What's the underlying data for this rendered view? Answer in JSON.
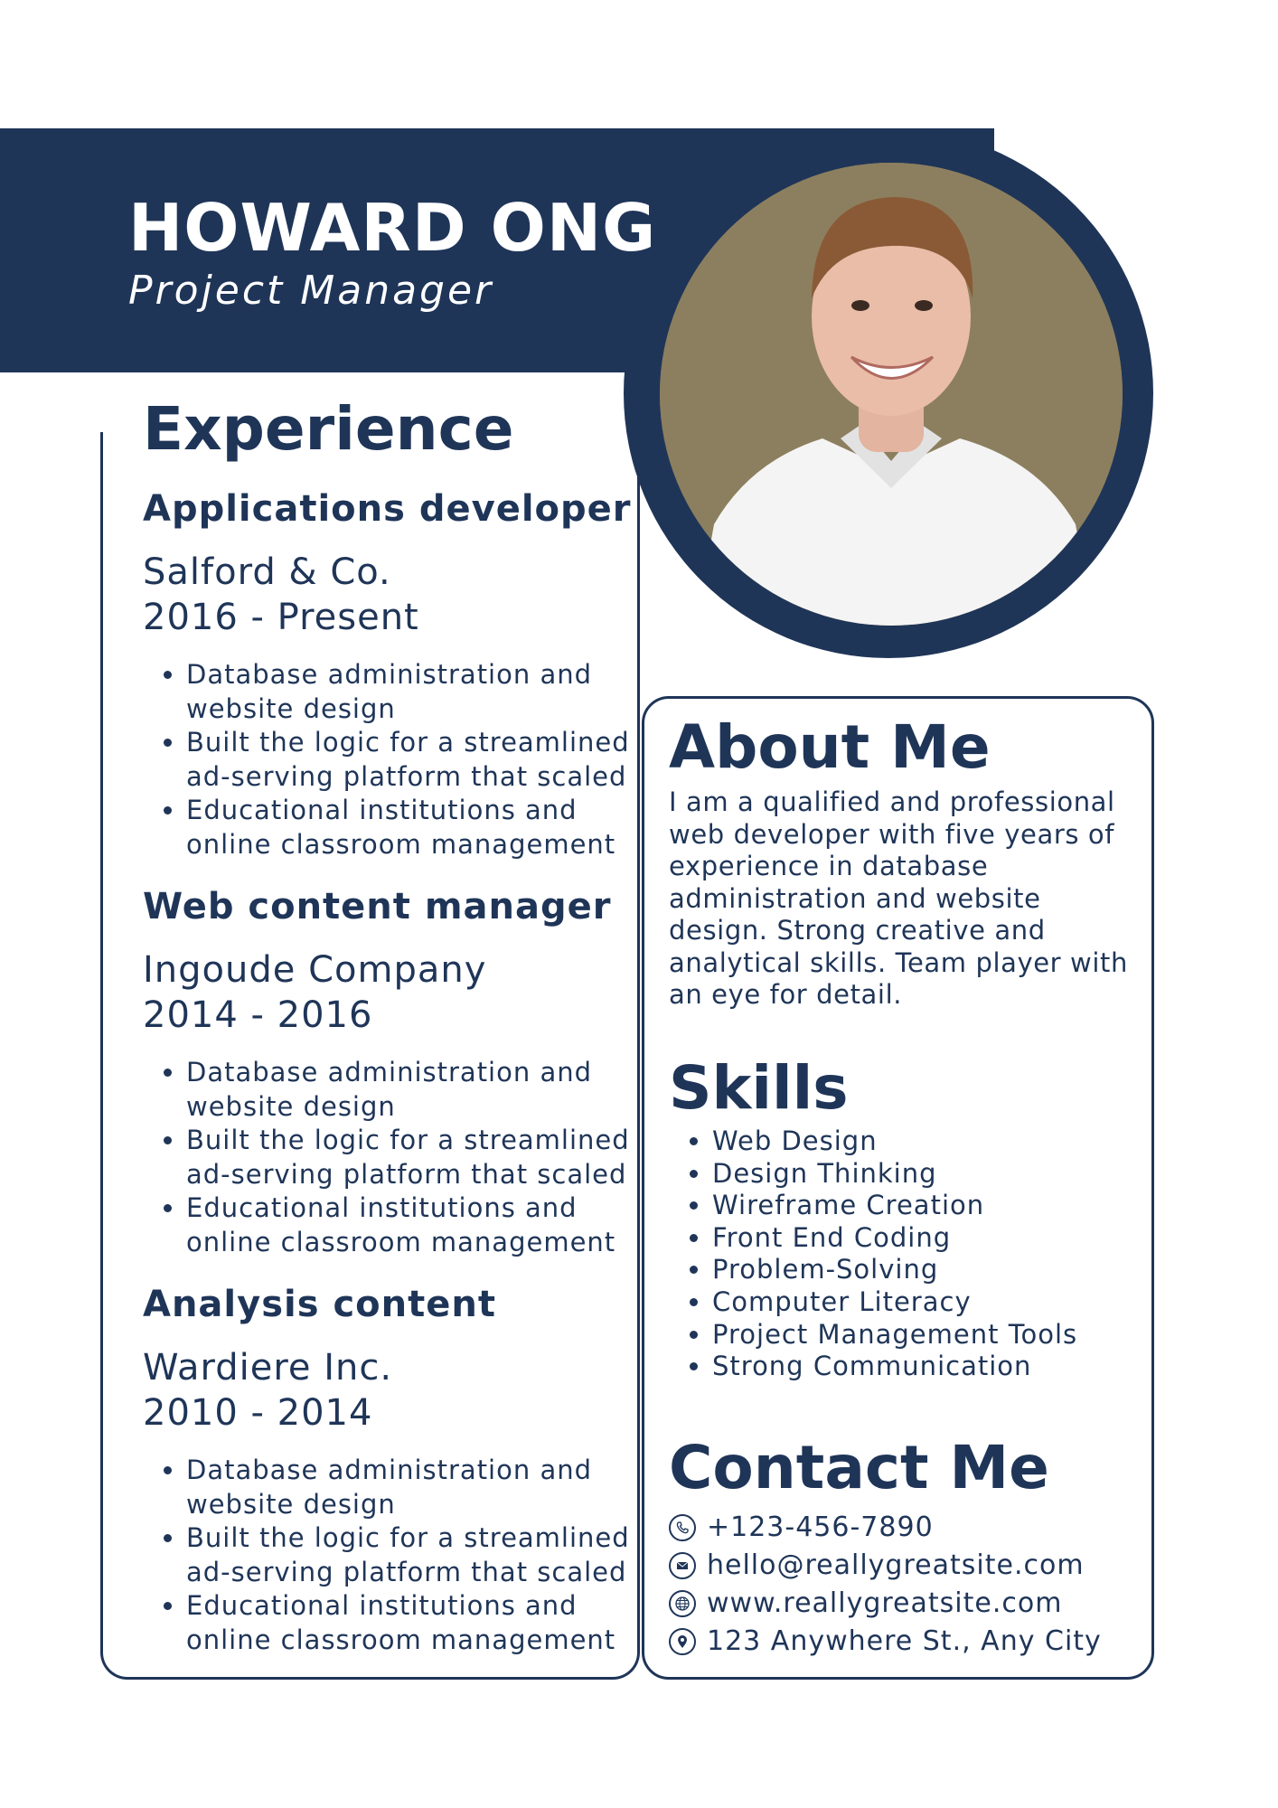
{
  "header": {
    "name": "HOWARD ONG",
    "role": "Project Manager"
  },
  "experience": {
    "heading": "Experience",
    "jobs": [
      {
        "title": "Applications developer",
        "company": "Salford & Co.",
        "years": "2016 - Present",
        "bullets": [
          "Database administration and\nwebsite design",
          "Built the logic for a streamlined\nad-serving platform that scaled",
          "Educational institutions and\nonline classroom management"
        ]
      },
      {
        "title": "Web content manager",
        "company": "Ingoude Company",
        "years": "2014 - 2016",
        "bullets": [
          "Database administration and\nwebsite design",
          "Built the logic for a streamlined\nad-serving platform that scaled",
          "Educational institutions and\nonline classroom management"
        ]
      },
      {
        "title": "Analysis content",
        "company": "Wardiere Inc.",
        "years": "2010 - 2014",
        "bullets": [
          "Database administration and\nwebsite design",
          "Built the logic for a streamlined\nad-serving platform that scaled",
          "Educational institutions and\nonline classroom management"
        ]
      }
    ]
  },
  "about": {
    "heading": "About Me",
    "text": "I am a qualified and professional web developer with five years of experience in database administration and website design. Strong creative and analytical skills. Team player with an eye for detail."
  },
  "skills": {
    "heading": "Skills",
    "items": [
      "Web Design",
      "Design Thinking",
      "Wireframe Creation",
      "Front End Coding",
      "Problem-Solving",
      "Computer Literacy",
      "Project Management Tools",
      "Strong Communication"
    ]
  },
  "contact": {
    "heading": "Contact Me",
    "phone": "+123-456-7890",
    "email": "hello@reallygreatsite.com",
    "website": "www.reallygreatsite.com",
    "address": "123 Anywhere St., Any City"
  },
  "colors": {
    "primary": "#1f3558",
    "background": "#ffffff"
  },
  "icons": [
    "phone-icon",
    "email-icon",
    "globe-icon",
    "location-icon"
  ]
}
